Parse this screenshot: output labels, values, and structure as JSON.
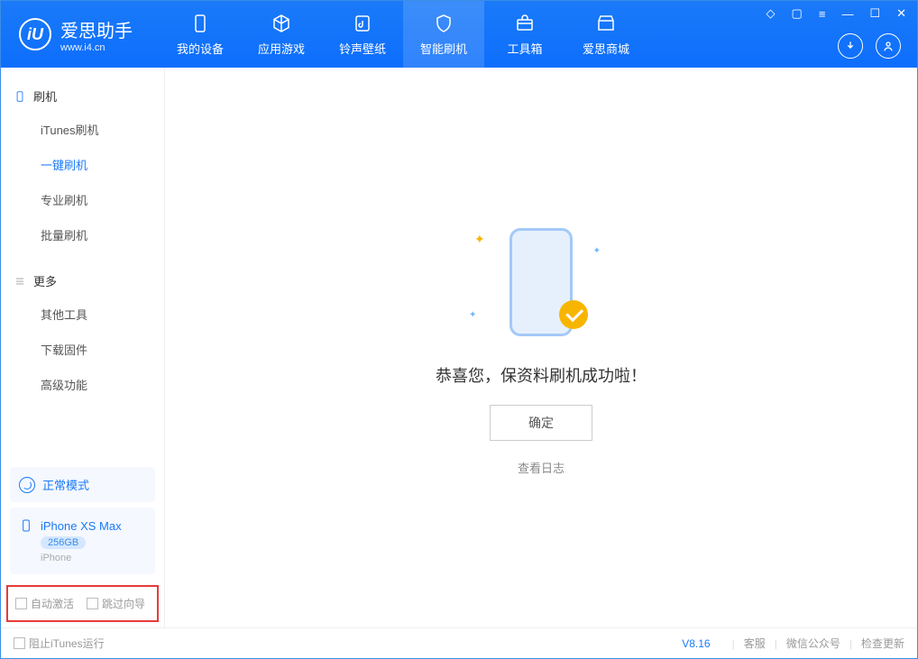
{
  "app": {
    "name": "爱思助手",
    "url": "www.i4.cn"
  },
  "nav": {
    "my_device": "我的设备",
    "apps_games": "应用游戏",
    "ring_wall": "铃声壁纸",
    "smart_flash": "智能刷机",
    "toolbox": "工具箱",
    "store": "爱思商城"
  },
  "sidebar": {
    "flash_header": "刷机",
    "items": {
      "itunes_flash": "iTunes刷机",
      "one_key_flash": "一键刷机",
      "pro_flash": "专业刷机",
      "batch_flash": "批量刷机"
    },
    "more_header": "更多",
    "more_items": {
      "other_tools": "其他工具",
      "download_firmware": "下载固件",
      "advanced": "高级功能"
    },
    "mode": "正常模式",
    "device": {
      "name": "iPhone XS Max",
      "storage": "256GB",
      "type": "iPhone"
    },
    "auto_activate": "自动激活",
    "skip_guide": "跳过向导"
  },
  "main": {
    "success_text": "恭喜您，保资料刷机成功啦！",
    "ok_button": "确定",
    "view_log": "查看日志"
  },
  "footer": {
    "block_itunes": "阻止iTunes运行",
    "version": "V8.16",
    "support": "客服",
    "wechat": "微信公众号",
    "update": "检查更新"
  }
}
